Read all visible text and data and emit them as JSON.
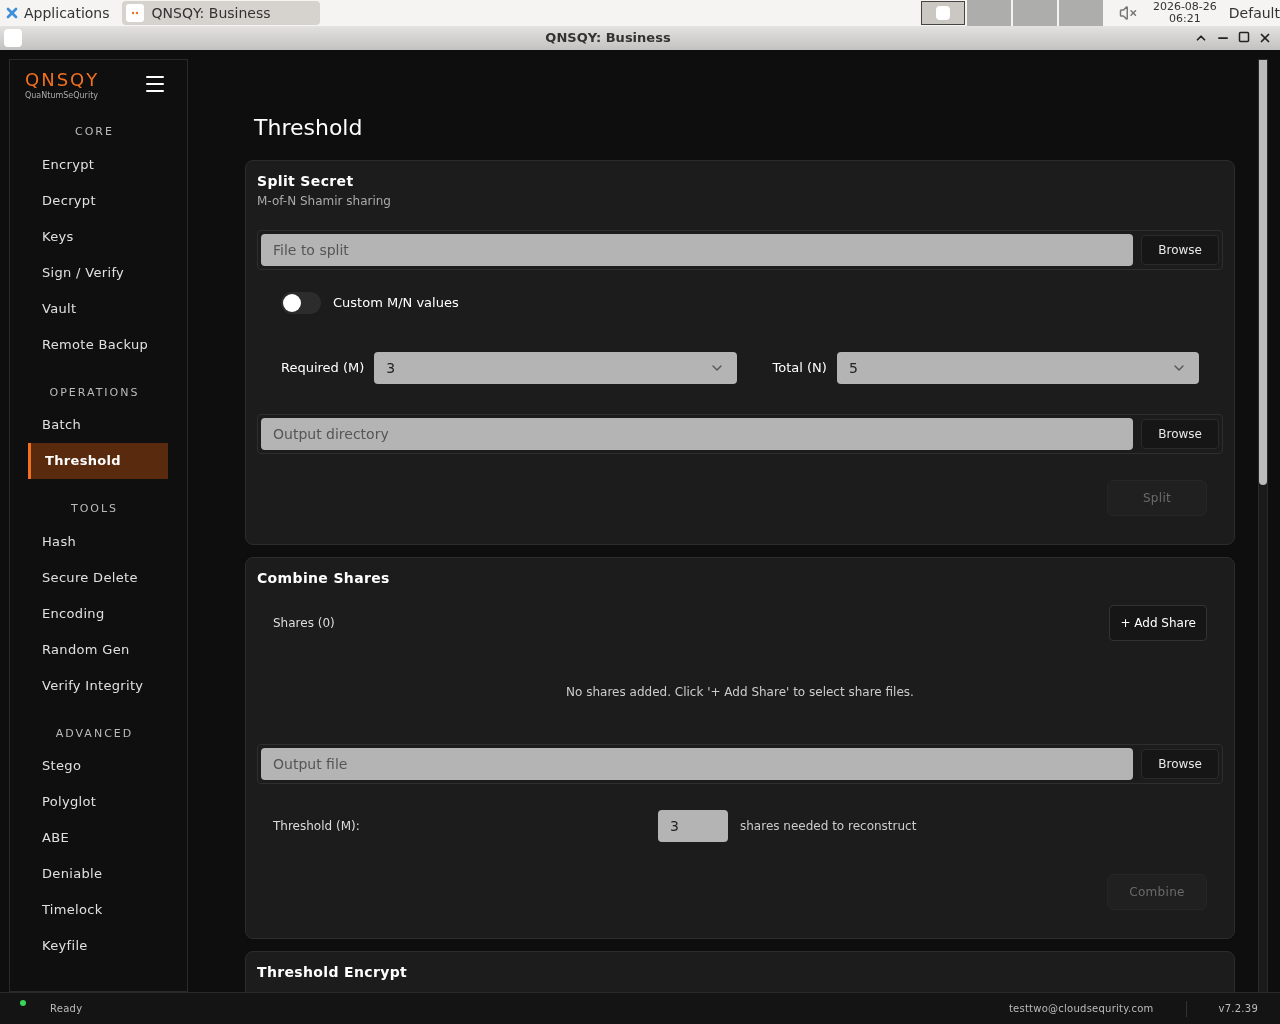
{
  "taskbar": {
    "apps_label": "Applications",
    "window_button": "QNSQY: Business",
    "date": "2026-08-26",
    "time": "06:21",
    "layout": "Default"
  },
  "window": {
    "title": "QNSQY: Business"
  },
  "sidebar": {
    "logo": "QNSQY",
    "tagline": "QuaNtumSeQurity",
    "sections": [
      {
        "heading": "CORE",
        "items": [
          {
            "label": "Encrypt",
            "selected": false
          },
          {
            "label": "Decrypt",
            "selected": false
          },
          {
            "label": "Keys",
            "selected": false
          },
          {
            "label": "Sign / Verify",
            "selected": false
          },
          {
            "label": "Vault",
            "selected": false
          },
          {
            "label": "Remote Backup",
            "selected": false
          }
        ]
      },
      {
        "heading": "OPERATIONS",
        "items": [
          {
            "label": "Batch",
            "selected": false
          },
          {
            "label": "Threshold",
            "selected": true
          }
        ]
      },
      {
        "heading": "TOOLS",
        "items": [
          {
            "label": "Hash",
            "selected": false
          },
          {
            "label": "Secure Delete",
            "selected": false
          },
          {
            "label": "Encoding",
            "selected": false
          },
          {
            "label": "Random Gen",
            "selected": false
          },
          {
            "label": "Verify Integrity",
            "selected": false
          }
        ]
      },
      {
        "heading": "ADVANCED",
        "items": [
          {
            "label": "Stego",
            "selected": false
          },
          {
            "label": "Polyglot",
            "selected": false
          },
          {
            "label": "ABE",
            "selected": false
          },
          {
            "label": "Deniable",
            "selected": false
          },
          {
            "label": "Timelock",
            "selected": false
          },
          {
            "label": "Keyfile",
            "selected": false
          }
        ]
      }
    ]
  },
  "page": {
    "title": "Threshold",
    "split": {
      "title": "Split Secret",
      "subtitle": "M-of-N Shamir sharing",
      "file_placeholder": "File to split",
      "file_browse": "Browse",
      "toggle": {
        "label": "Custom M/N values",
        "on": false
      },
      "required_label": "Required (M)",
      "required_value": "3",
      "total_label": "Total (N)",
      "total_value": "5",
      "output_placeholder": "Output directory",
      "output_browse": "Browse",
      "action": {
        "label": "Split",
        "disabled": true
      }
    },
    "combine": {
      "title": "Combine Shares",
      "shares_label": "Shares (0)",
      "add_button": "+ Add Share",
      "empty_message": "No shares added. Click '+ Add Share' to select share files.",
      "output_placeholder": "Output file",
      "output_browse": "Browse",
      "threshold_label": "Threshold (M):",
      "threshold_value": "3",
      "threshold_hint": "shares needed to reconstruct",
      "action": {
        "label": "Combine",
        "disabled": true
      }
    },
    "encrypt": {
      "title": "Threshold Encrypt"
    }
  },
  "status_bar": {
    "text": "Ready",
    "user": "testtwo@cloudsequrity.com",
    "version": "v7.2.39"
  }
}
